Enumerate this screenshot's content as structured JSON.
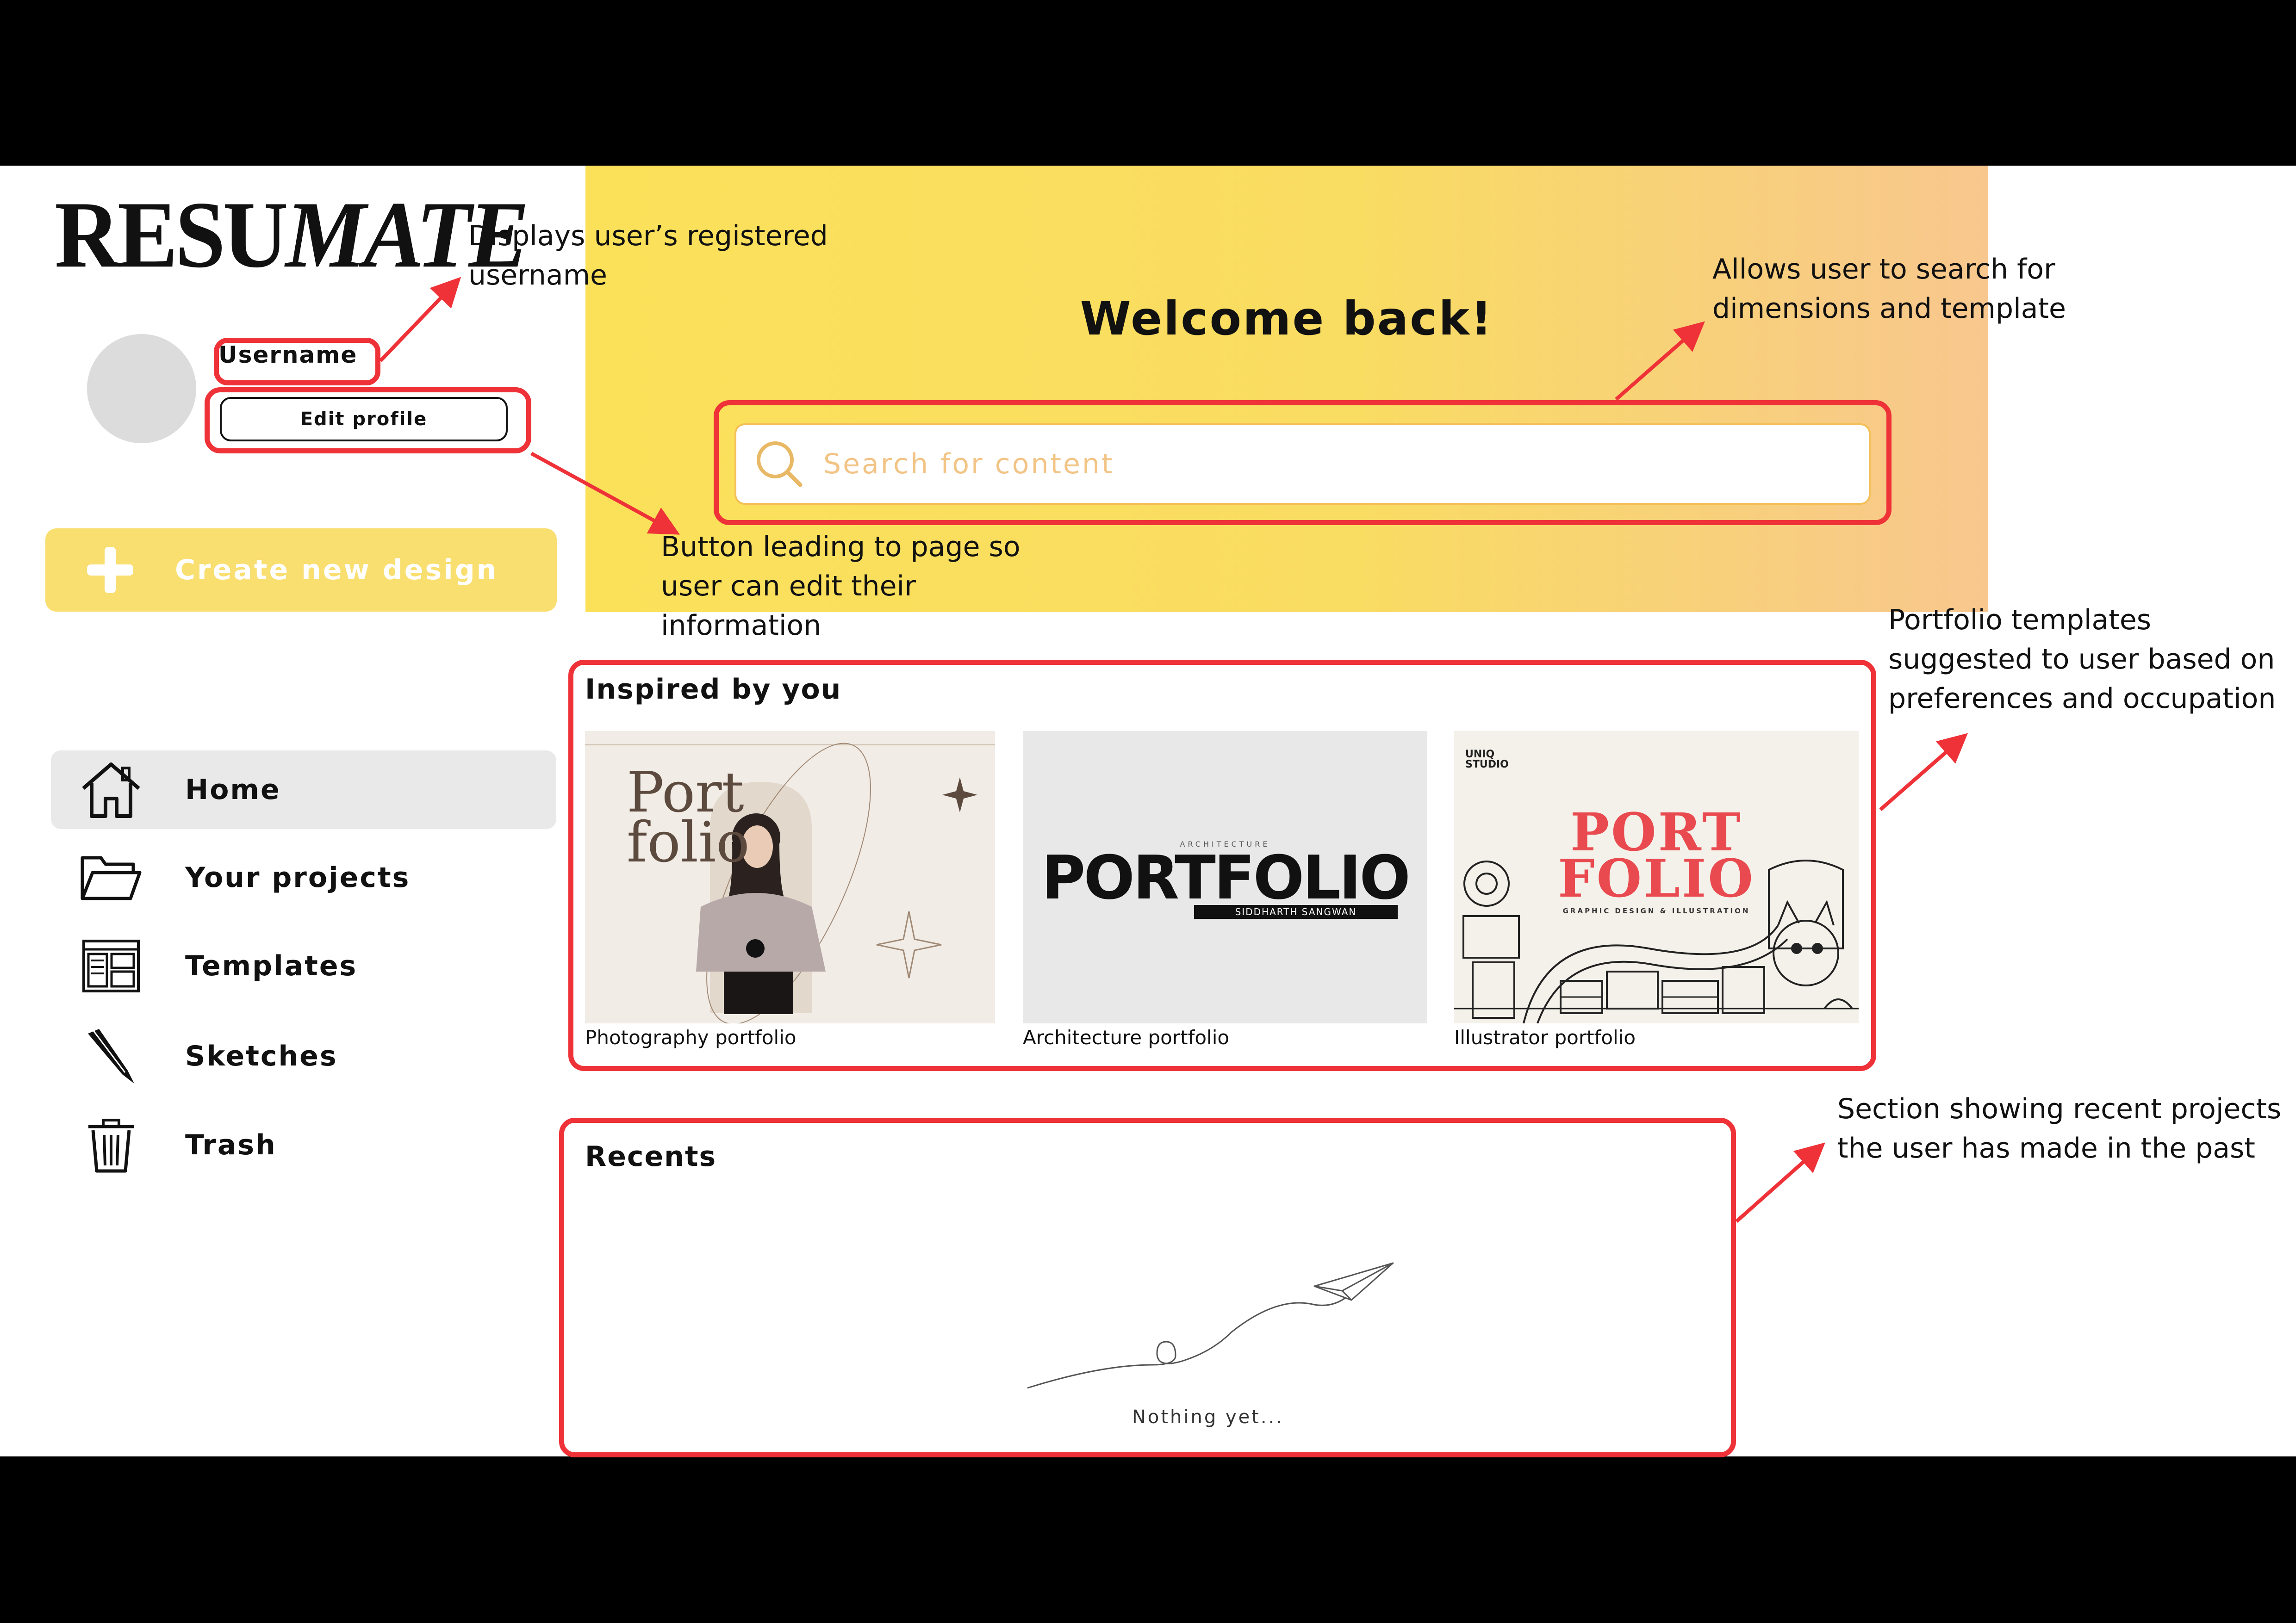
{
  "app": {
    "logo_part1": "RESU",
    "logo_part2": "MATE"
  },
  "profile": {
    "username": "Username",
    "edit_profile_label": "Edit profile"
  },
  "create": {
    "label": "Create new design"
  },
  "nav": {
    "items": [
      {
        "label": "Home",
        "icon": "home-icon",
        "active": true
      },
      {
        "label": "Your projects",
        "icon": "folder-icon"
      },
      {
        "label": "Templates",
        "icon": "templates-icon"
      },
      {
        "label": "Sketches",
        "icon": "pen-icon"
      },
      {
        "label": "Trash",
        "icon": "trash-icon"
      }
    ]
  },
  "hero": {
    "welcome": "Welcome back!",
    "search_placeholder": "Search for content"
  },
  "inspired": {
    "heading": "Inspired by you",
    "cards": [
      {
        "caption": "Photography portfolio",
        "title_line1": "Port",
        "title_line2": "folio"
      },
      {
        "caption": "Architecture portfolio",
        "title": "PORTFOLIO",
        "subtitle": "ARCHITECTURE",
        "author": "SIDDHARTH SANGWAN"
      },
      {
        "caption": "Illustrator portfolio",
        "title_line1": "PORT",
        "title_line2": "FOLIO",
        "studio": "UNIQ STUDIO",
        "subtitle": "GRAPHIC DESIGN & ILLUSTRATION"
      }
    ]
  },
  "recents": {
    "heading": "Recents",
    "empty_text": "Nothing yet..."
  },
  "annotations": {
    "username": "Displays user’s registered username",
    "search": "Allows user to search for dimensions and template",
    "edit_button": "Button leading to page so user can edit their information",
    "templates": "Portfolio templates suggested to user based on preferences and occupation",
    "recents": "Section showing recent projects the user has made in the past"
  },
  "colors": {
    "accent_yellow": "#f9de70",
    "annotation_red": "#ee3238",
    "hero_start": "#fbe15a",
    "hero_end": "#f8c78e"
  }
}
